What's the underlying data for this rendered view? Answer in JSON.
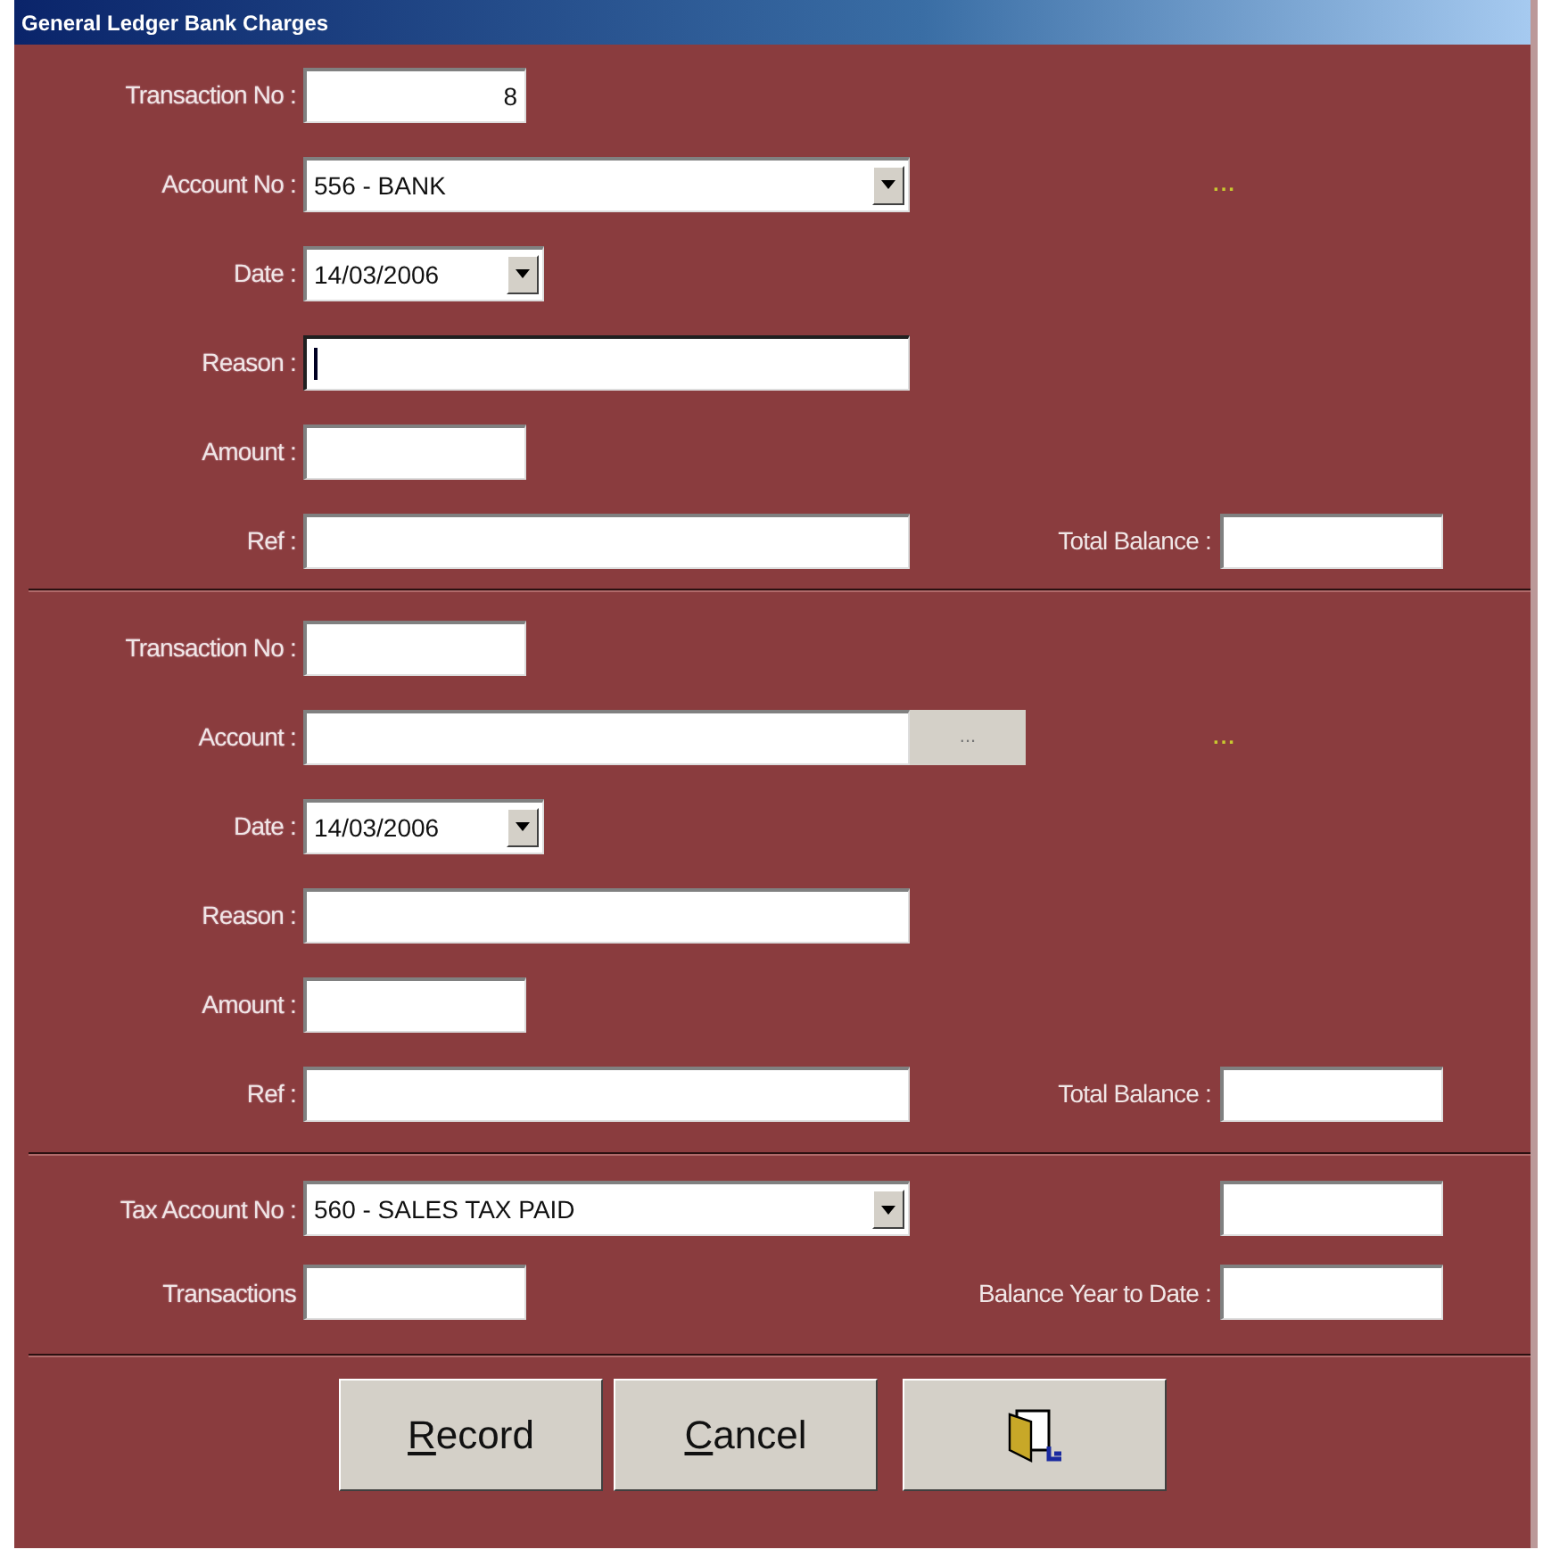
{
  "window": {
    "title": "General Ledger Bank Charges"
  },
  "sections": [
    {
      "transaction_no": {
        "label": "Transaction No :",
        "value": "8"
      },
      "account": {
        "kind": "combo",
        "label": "Account No :",
        "value": "556 - BANK"
      },
      "indicator": "...",
      "date": {
        "label": "Date :",
        "value": "14/03/2006"
      },
      "reason": {
        "label": "Reason :",
        "focused": true
      },
      "amount": {
        "label": "Amount :"
      },
      "ref": {
        "label": "Ref :"
      },
      "total_balance": {
        "label": "Total Balance :"
      }
    },
    {
      "transaction_no": {
        "label": "Transaction No :"
      },
      "account": {
        "kind": "browse",
        "label": "Account :",
        "button": "..."
      },
      "indicator": "...",
      "date": {
        "label": "Date :",
        "value": "14/03/2006"
      },
      "reason": {
        "label": "Reason :",
        "focused": false
      },
      "amount": {
        "label": "Amount :"
      },
      "ref": {
        "label": "Ref :"
      },
      "total_balance": {
        "label": "Total Balance :"
      }
    }
  ],
  "tax": {
    "account": {
      "label": "Tax Account No :",
      "value": "560 - SALES TAX PAID"
    },
    "transactions": {
      "label": "Transactions"
    },
    "balance_ytd": {
      "label": "Balance Year to Date :"
    }
  },
  "buttons": [
    {
      "kind": "text",
      "label": "Record",
      "underline_first": true
    },
    {
      "kind": "text",
      "label": "Cancel",
      "underline_first": true
    },
    {
      "kind": "icon"
    }
  ]
}
